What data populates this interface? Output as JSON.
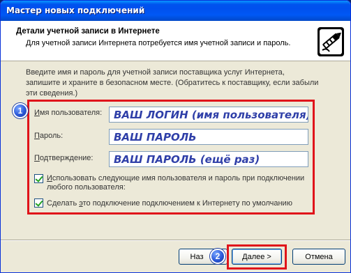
{
  "window": {
    "title": "Мастер новых подключений"
  },
  "header": {
    "title": "Детали учетной записи в Интернете",
    "subtitle": "Для учетной записи Интернета потребуется имя учетной записи и пароль.",
    "icon": "key-card-icon"
  },
  "intro": "Введите имя и пароль для учетной записи поставщика услуг Интернета, запишите и храните в безопасном месте. (Обратитесь к поставщику, если забыли эти сведения.)",
  "markers": {
    "first": "1",
    "second": "2"
  },
  "form": {
    "username_label_u": "И",
    "username_label_rest": "мя пользователя:",
    "username_value": "ВАШ ЛОГИН (имя пользователя)",
    "password_label_u": "П",
    "password_label_rest": "ароль:",
    "password_value": "ВАШ ПАРОЛЬ",
    "confirm_label_u": "П",
    "confirm_label_rest": "одтверждение:",
    "confirm_value": "ВАШ ПАРОЛЬ (ещё раз)"
  },
  "checkboxes": [
    {
      "u": "И",
      "line1_rest": "спользовать следующие имя пользователя и пароль при подключении",
      "line2": "любого пользователя:",
      "checked": true
    },
    {
      "pre": "Сделать ",
      "u": "э",
      "rest": "то подключение подключением к Интернету по умолчанию",
      "checked": true
    }
  ],
  "buttons": {
    "back_pre": "Наз",
    "next_u": "Д",
    "next_rest": "алее >",
    "cancel": "Отмена"
  },
  "colors": {
    "accent_red": "#e0131a",
    "input_text": "#2f3fa8",
    "titlebar": "#0053ee"
  }
}
